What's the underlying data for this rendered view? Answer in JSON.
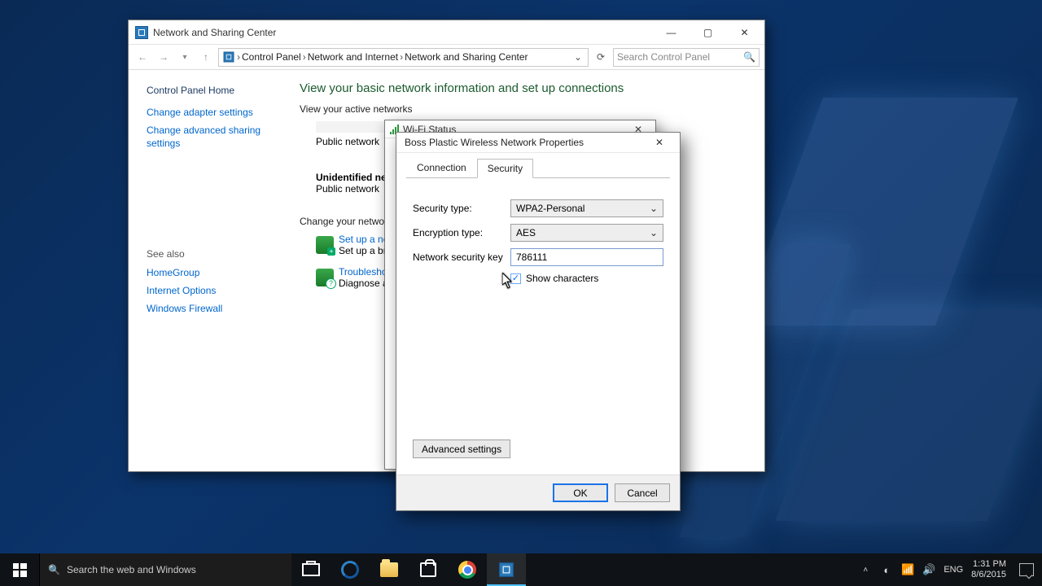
{
  "cp": {
    "title": "Network and Sharing Center",
    "breadcrumbs": [
      "Control Panel",
      "Network and Internet",
      "Network and Sharing Center"
    ],
    "search_placeholder": "Search Control Panel",
    "side": {
      "home": "Control Panel Home",
      "adapter": "Change adapter settings",
      "advanced": "Change advanced sharing settings",
      "seealso_label": "See also",
      "seealso": [
        "HomeGroup",
        "Internet Options",
        "Windows Firewall"
      ]
    },
    "main": {
      "heading": "View your basic network information and set up connections",
      "active_lbl": "View your active networks",
      "public1": "Public network",
      "unidentified": "Unidentified netw",
      "public2": "Public network",
      "change_lbl": "Change your network",
      "setup_link": "Set up a ne",
      "setup_desc": "Set up a bro",
      "trouble_link": "Troublesho",
      "trouble_desc": "Diagnose an"
    }
  },
  "wifi": {
    "title": "Wi-Fi Status"
  },
  "props": {
    "title": "Boss Plastic Wireless Network Properties",
    "tabs": {
      "connection": "Connection",
      "security": "Security"
    },
    "labels": {
      "sec_type": "Security type:",
      "enc_type": "Encryption type:",
      "key": "Network security key"
    },
    "values": {
      "sec_type": "WPA2-Personal",
      "enc_type": "AES",
      "key": "786111"
    },
    "show_chars": "Show characters",
    "advanced": "Advanced settings",
    "ok": "OK",
    "cancel": "Cancel"
  },
  "taskbar": {
    "search_placeholder": "Search the web and Windows",
    "lang": "ENG",
    "time": "1:31 PM",
    "date": "8/6/2015"
  }
}
